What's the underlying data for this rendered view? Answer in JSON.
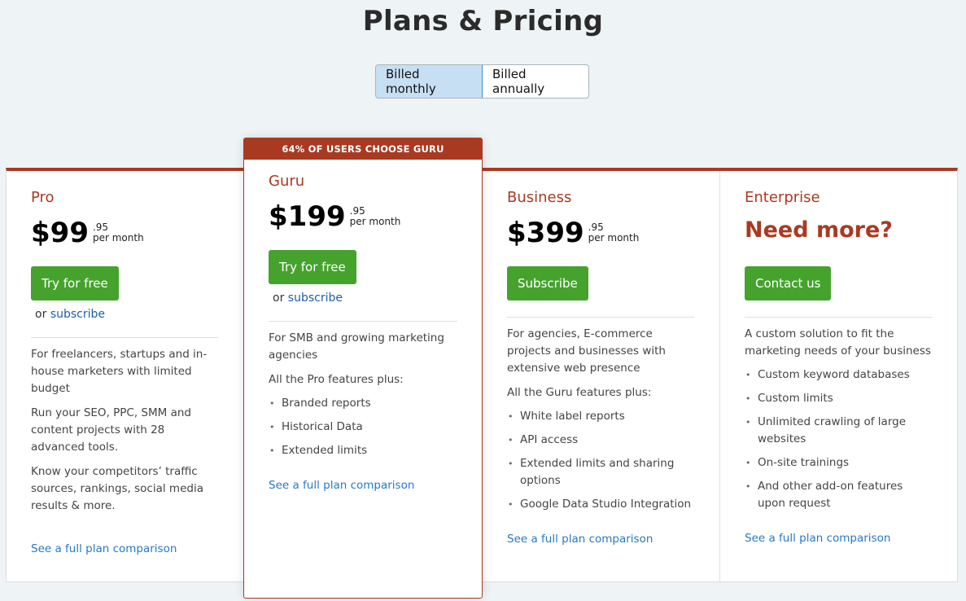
{
  "page": {
    "title": "Plans & Pricing"
  },
  "billing_toggle": {
    "options": [
      {
        "label": "Billed monthly",
        "selected": true
      },
      {
        "label": "Billed annually",
        "selected": false
      }
    ]
  },
  "colors": {
    "brand": "#a83a22",
    "cta_green": "#45a32d",
    "link_blue": "#2878c8",
    "toggle_active_bg": "#c7dff3"
  },
  "plans": [
    {
      "name": "Pro",
      "price_whole": "$99",
      "price_cents": ".95",
      "price_period": "per month",
      "cta_label": "Try for free",
      "or_text": "or",
      "subscribe_link": "subscribe",
      "paragraphs": [
        "For freelancers, startups and in-house marketers with limited budget",
        "Run your SEO, PPC, SMM and content projects with 28 advanced tools.",
        "Know your competitors’ traffic sources, rankings, social media results & more."
      ],
      "features": [],
      "compare_link": "See a full plan comparison"
    },
    {
      "name": "Guru",
      "badge": "64% OF USERS CHOOSE GURU",
      "price_whole": "$199",
      "price_cents": ".95",
      "price_period": "per month",
      "cta_label": "Try for free",
      "or_text": "or",
      "subscribe_link": "subscribe",
      "paragraphs": [
        "For SMB and growing marketing agencies",
        "All the Pro features plus:"
      ],
      "features": [
        "Branded reports",
        "Historical Data",
        "Extended limits"
      ],
      "compare_link": "See a full plan comparison"
    },
    {
      "name": "Business",
      "price_whole": "$399",
      "price_cents": ".95",
      "price_period": "per month",
      "cta_label": "Subscribe",
      "paragraphs": [
        "For agencies, E-commerce projects and businesses with extensive web presence",
        "All the Guru features plus:"
      ],
      "features": [
        "White label reports",
        "API access",
        "Extended limits and sharing options",
        "Google Data Studio Integration"
      ],
      "compare_link": "See a full plan comparison"
    },
    {
      "name": "Enterprise",
      "headline": "Need more?",
      "cta_label": "Contact us",
      "paragraphs": [
        "A custom solution to fit the marketing needs of your business"
      ],
      "features": [
        "Custom keyword databases",
        "Custom limits",
        "Unlimited crawling of large websites",
        "On-site trainings",
        "And other add-on features upon request"
      ],
      "compare_link": "See a full plan comparison"
    }
  ]
}
